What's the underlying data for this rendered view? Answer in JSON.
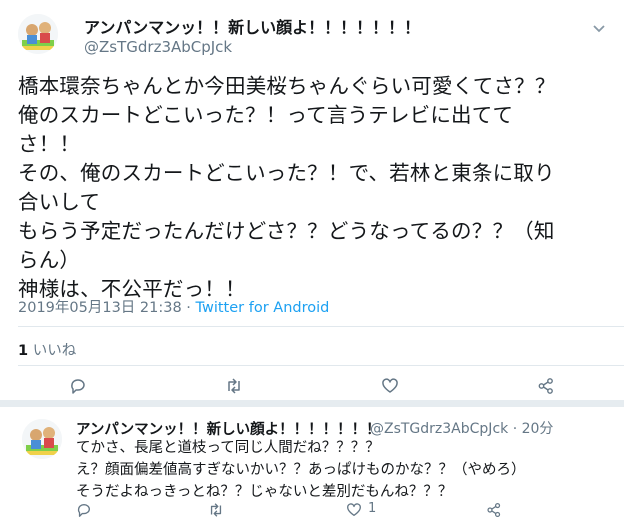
{
  "main_tweet": {
    "display_name": "アンパンマンッ！！新しい顔よ！！！！！！！",
    "handle": "@ZsTGdrz3AbCpJck",
    "text": "橋本環奈ちゃんとか今田美桜ちゃんぐらい可愛くてさ？？\n俺のスカートどこいった？！って言うテレビに出てて\nさ！！\nその、俺のスカートどこいった？！で、若林と東条に取り\n合いして\nもらう予定だったんだけどさ？？どうなってるの？？（知\nらん）\n神様は、不公平だっ！！",
    "timestamp": "2019年05月13日 21:38",
    "separator": " · ",
    "source": "Twitter for Android",
    "like_count": "1",
    "like_label": " いいね",
    "icons": [
      "avatar",
      "chevron-down-icon",
      "reply-icon",
      "retweet-icon",
      "like-icon",
      "share-icon"
    ]
  },
  "reply_tweet": {
    "display_name": "アンパンマンッ！！新しい顔よ！！！！！！！",
    "handle_time": "@ZsTGdrz3AbCpJck · 20分",
    "text": "てかさ、長尾と道枝って同じ人間だね？？？？\nえ？顔面偏差値高すぎないかい？？あっぱけものかな？？（やめろ）\nそうだよねっきっとね？？じゃないと差別だもんね？？？",
    "like_count": "1",
    "icons": [
      "avatar",
      "reply-icon",
      "retweet-icon",
      "like-icon",
      "share-icon"
    ]
  },
  "colors": {
    "text": "#14171a",
    "secondary": "#657786",
    "link": "#1da1f2",
    "divider": "#e1e8ed",
    "gap": "#e6ecf0"
  }
}
